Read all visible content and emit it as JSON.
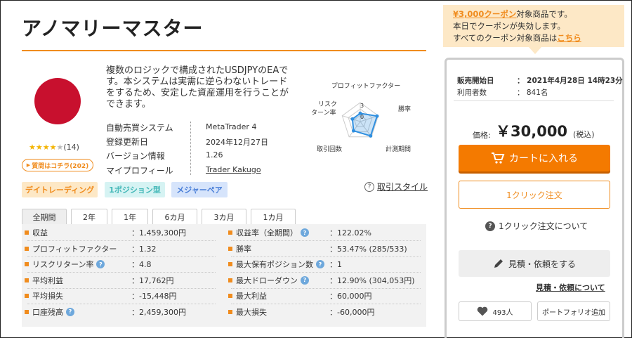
{
  "title": "アノマリーマスター",
  "rating": {
    "stars_filled": 4,
    "stars_total": 5,
    "stars_text": "★★★★",
    "stars_off_text": "★",
    "count": "(14)"
  },
  "question_button": "質問はコチラ(202)",
  "description": "複数のロジックで構成されたUSDJPYのEAです。本システムは実需に逆らわないトレードをするため、安定した資産運用を行うことができます。",
  "info": [
    {
      "label": "自動売買システム",
      "value": "MetaTrader 4"
    },
    {
      "label": "登録更新日",
      "value": "2024年12月27日"
    },
    {
      "label": "バージョン情報",
      "value": "1.26"
    },
    {
      "label": "マイプロフィール",
      "value": "Trader Kakugo"
    }
  ],
  "radar": {
    "labels": [
      "プロフィットファクター",
      "勝率",
      "計測期間",
      "取引回数",
      "リスク",
      "ターン率"
    ],
    "scale_labels": [
      "3",
      "0"
    ],
    "values": [
      1.3,
      2.8,
      2.8,
      1.8,
      1.3
    ]
  },
  "tags": [
    "デイトレーディング",
    "1ポジション型",
    "メジャーペア"
  ],
  "style_link": "取引スタイル",
  "period_tabs": [
    "全期間",
    "2年",
    "1年",
    "6カ月",
    "3カ月",
    "1カ月"
  ],
  "stats_left": [
    {
      "label": "収益",
      "value": "：1,459,300円",
      "help": false
    },
    {
      "label": "プロフィットファクター",
      "value": "：1.32",
      "help": false
    },
    {
      "label": "リスクリターン率",
      "value": "：4.8",
      "help": true
    },
    {
      "label": "平均利益",
      "value": "：17,762円",
      "help": false
    },
    {
      "label": "平均損失",
      "value": "：-15,448円",
      "help": false
    },
    {
      "label": "口座残高",
      "value": "：2,459,300円",
      "help": true
    }
  ],
  "stats_right": [
    {
      "label": "収益率（全期間）",
      "value": "：122.02%",
      "help": true
    },
    {
      "label": "勝率",
      "value": "：53.47% (285/533)",
      "help": false
    },
    {
      "label": "最大保有ポジション数",
      "value": "：1",
      "help": true
    },
    {
      "label": "最大ドローダウン",
      "value": "：12.90% (304,053円)",
      "help": true
    },
    {
      "label": "最大利益",
      "value": "：60,000円",
      "help": false
    },
    {
      "label": "最大損失",
      "value": "：-60,000円",
      "help": false
    }
  ],
  "help_glyph": "?",
  "coupon": {
    "link": "¥3,000クーポン",
    "line1_rest": "対象商品です。",
    "line2": "本日でクーポンが失効します。",
    "line3": "すべてのクーポン対象商品は",
    "line3_link": "こちら"
  },
  "sale": {
    "start_label": "販売開始日",
    "start_value": "：  2021年4月28日 14時23分",
    "users_label": "利用者数",
    "users_value": "：  841名"
  },
  "price": {
    "label": "価格:",
    "value": "￥30,000",
    "tax": "(税込)"
  },
  "cart_button": "カートに入れる",
  "oneclick_button": "1クリック注文",
  "oneclick_about": "1クリック注文について",
  "estimate_button": "見積・依頼をする",
  "estimate_about": "見積・依頼について",
  "likes": "493人",
  "portfolio_button": "ポートフォリオ追加",
  "colors": {
    "accent": "#f08c1e",
    "flag": "#c8102e",
    "radar": "#2f8fe0"
  }
}
